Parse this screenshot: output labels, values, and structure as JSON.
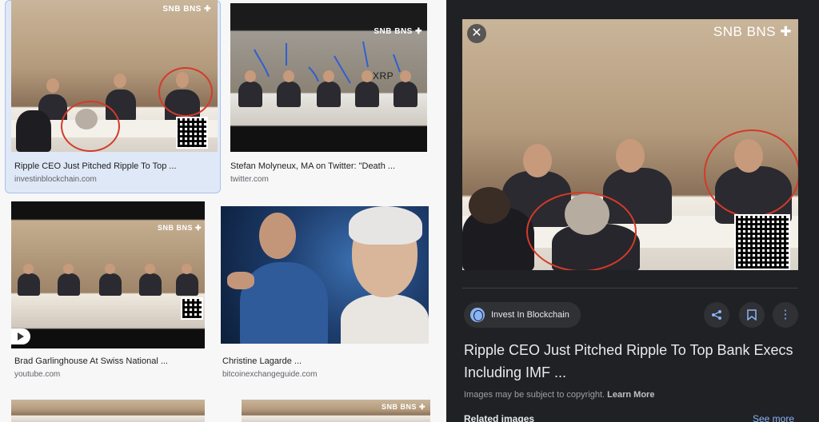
{
  "results": [
    {
      "caption": "Ripple CEO Just Pitched Ripple To Top ...",
      "source": "investinblockchain.com",
      "watermark": "SNB BNS ✚"
    },
    {
      "caption": "Stefan Molyneux, MA on Twitter: \"Death ...",
      "source": "twitter.com",
      "watermark": "SNB BNS ✚",
      "overlay_text": "XRP"
    },
    {
      "caption": "Brad Garlinghouse At Swiss National ...",
      "source": "youtube.com",
      "watermark": "SNB BNS ✚"
    },
    {
      "caption": "Christine Lagarde ...",
      "source": "bitcoinexchangeguide.com"
    },
    {
      "watermark": "SNB BNS ✚"
    }
  ],
  "panel": {
    "watermark": "SNB BNS ✚",
    "close_icon": "close-icon",
    "source_chip": "Invest In Blockchain",
    "title": "Ripple CEO Just Pitched Ripple To Top Bank Execs Including IMF ...",
    "copyright_text": "Images may be subject to copyright.",
    "learn_more": "Learn More",
    "related_label": "Related images",
    "see_more": "See more",
    "icons": [
      "share-icon",
      "bookmark-icon",
      "more-vert-icon"
    ]
  },
  "colors": {
    "panel_bg": "#202124",
    "accent": "#8ab4f8",
    "highlight_circle": "#d43a2a"
  }
}
